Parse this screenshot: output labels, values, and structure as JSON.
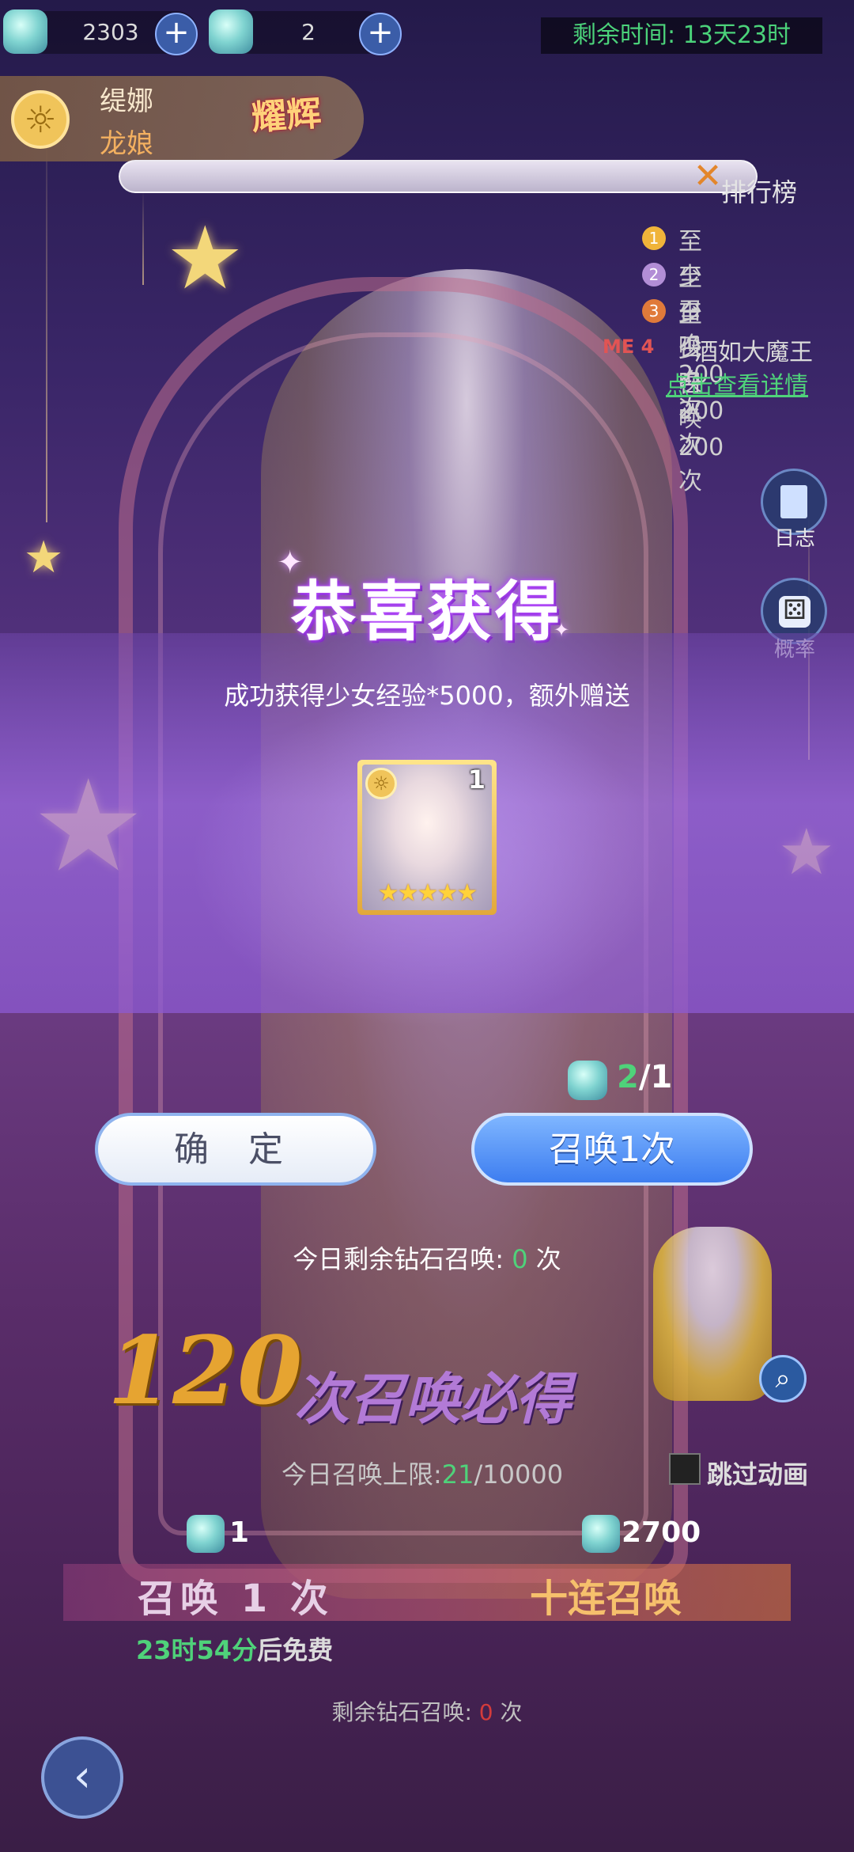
{
  "resources": {
    "crystal_value": "2303",
    "gem_value": "2",
    "plus_glyph": "+",
    "timer": "剩余时间: 13天23时"
  },
  "character": {
    "name": "缇娜",
    "race": "龙娘",
    "badge": "耀辉",
    "icon": "sun-emblem-icon"
  },
  "ranking": {
    "title": "排行榜",
    "items": [
      {
        "rank": "1",
        "text": "至少召唤200次",
        "color": "#f0b43a"
      },
      {
        "rank": "2",
        "text": "至少召唤200次",
        "color": "#b28ed6"
      },
      {
        "rank": "3",
        "text": "至少召唤200次",
        "color": "#e07a3a"
      }
    ],
    "me_label": "ME 4",
    "me_text": "酒如大魔王",
    "detail_link": "点击查看详情"
  },
  "side_buttons": [
    {
      "label": "日志",
      "icon": "log-book-icon"
    },
    {
      "label": "概率",
      "icon": "dice-icon"
    }
  ],
  "popup": {
    "title": "恭喜获得",
    "subtitle": "成功获得少女经验*5000，额外赠送",
    "reward": {
      "count": "1",
      "stars": "★★★★★",
      "stars_value": 5
    },
    "cost_text": "2/1",
    "confirm_label": "确 定",
    "summon_label": "召唤1次",
    "today_left_prefix": "今日剩余钻石召唤:",
    "today_left_value": "0",
    "today_left_suffix": "次"
  },
  "lower": {
    "guarantee_number": "120",
    "guarantee_text": "次召唤必得",
    "limit_prefix": "今日召唤上限:",
    "limit_value": "21",
    "limit_total": "/10000",
    "skip_label": "跳过动画",
    "price_single": "1",
    "price_ten": "2700",
    "summon_single": "召唤 1 次",
    "summon_ten": "十连召唤",
    "free_time": "23时54分",
    "free_suffix": "后免费",
    "diamond_prefix": "剩余钻石召唤:",
    "diamond_value": "0",
    "diamond_suffix": "次"
  }
}
